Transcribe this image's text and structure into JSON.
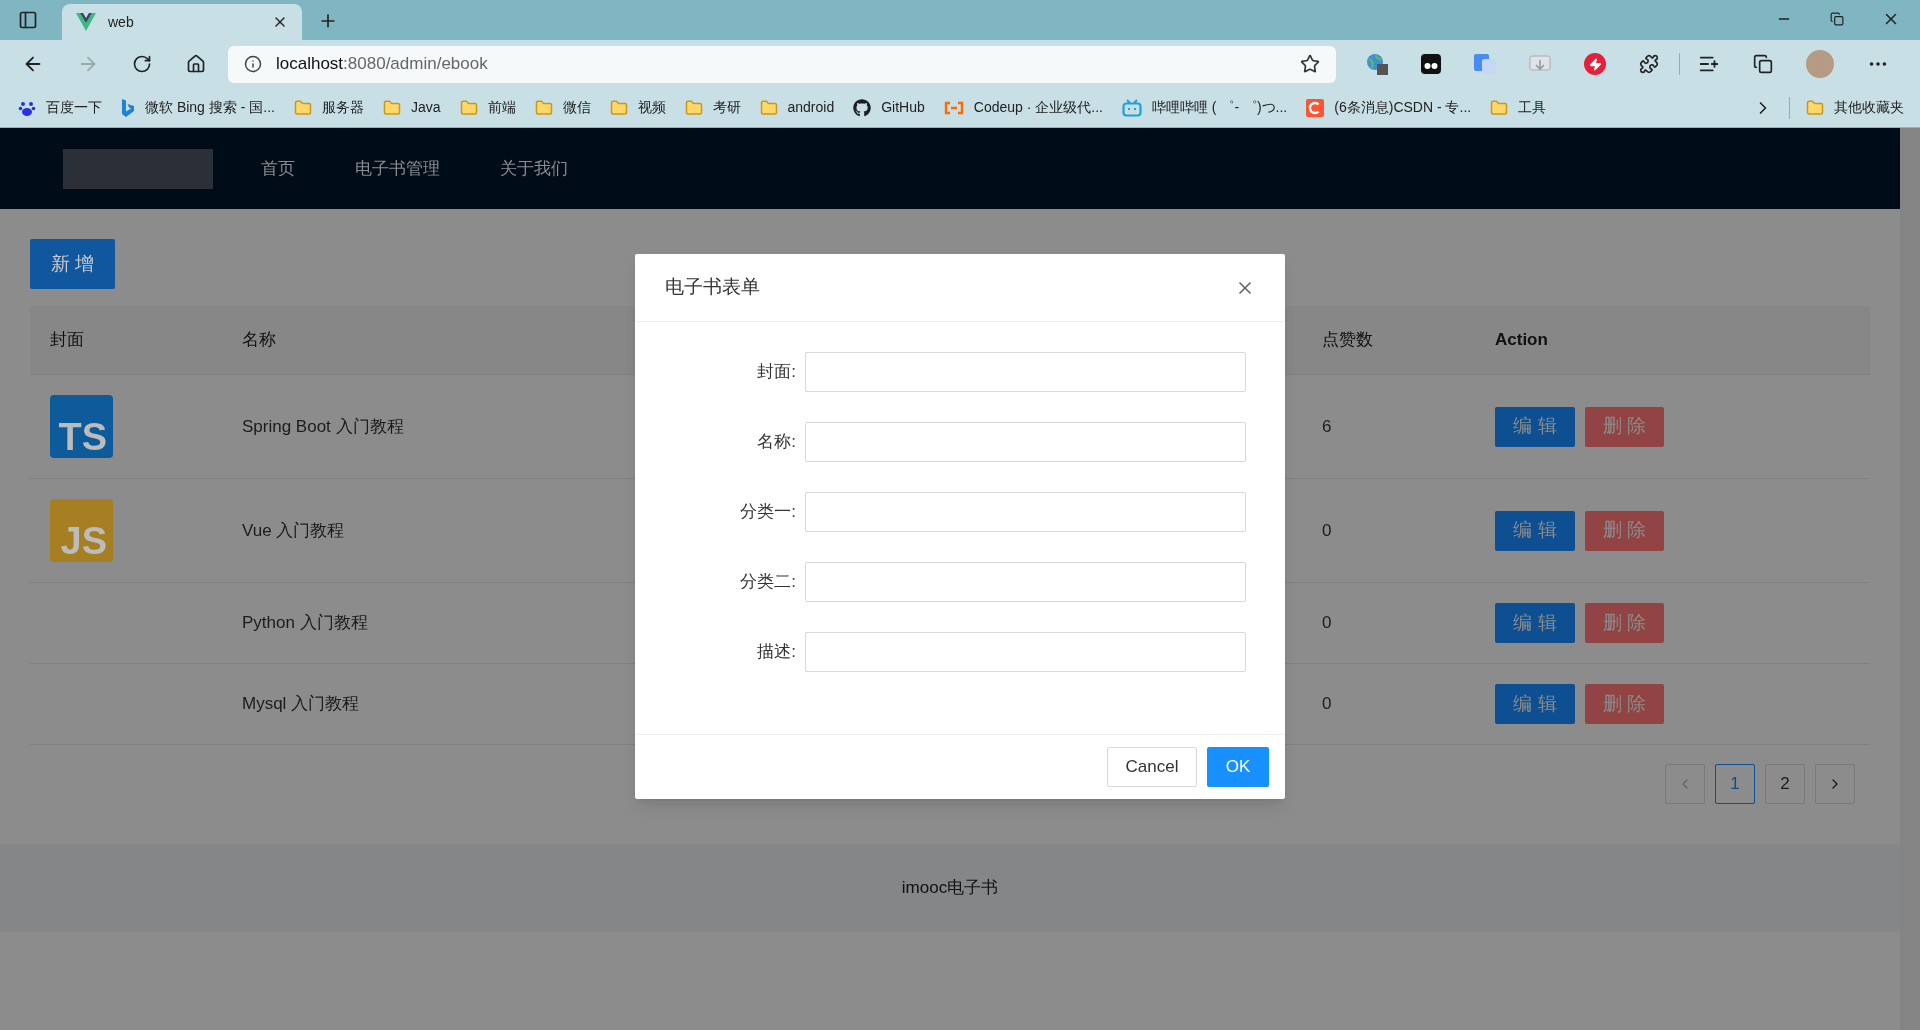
{
  "browser": {
    "tabs": [
      {
        "title": "web",
        "selected": true
      }
    ],
    "address": {
      "host": "localhost",
      "path": ":8080/admin/ebook"
    },
    "bookmarks": [
      {
        "kind": "baidu",
        "label": "百度一下"
      },
      {
        "kind": "bing",
        "label": "微软 Bing 搜索 - 国..."
      },
      {
        "kind": "folder",
        "label": "服务器"
      },
      {
        "kind": "folder",
        "label": "Java"
      },
      {
        "kind": "folder",
        "label": "前端"
      },
      {
        "kind": "folder",
        "label": "微信"
      },
      {
        "kind": "folder",
        "label": "视频"
      },
      {
        "kind": "folder",
        "label": "考研"
      },
      {
        "kind": "folder",
        "label": "android"
      },
      {
        "kind": "github",
        "label": "GitHub"
      },
      {
        "kind": "codeup",
        "label": "Codeup · 企业级代..."
      },
      {
        "kind": "bilibili",
        "label": "哔哩哔哩 ( ゜- ゜)つ..."
      },
      {
        "kind": "csdn",
        "label": "(6条消息)CSDN - 专..."
      },
      {
        "kind": "folder",
        "label": "工具"
      }
    ],
    "other_bookmarks": "其他收藏夹"
  },
  "header": {
    "nav": [
      "首页",
      "电子书管理",
      "关于我们"
    ]
  },
  "add_button": "新 增",
  "table": {
    "columns": [
      "封面",
      "名称",
      "点赞数",
      "Action"
    ],
    "rows": [
      {
        "cover": {
          "text": "TS",
          "color": "#0d5b9a"
        },
        "name": "Spring Boot 入门教程",
        "likes": "6",
        "actions": [
          "编 辑",
          "删 除"
        ]
      },
      {
        "cover": {
          "text": "JS",
          "color": "#a67f22"
        },
        "name": "Vue 入门教程",
        "likes": "0",
        "actions": [
          "编 辑",
          "删 除"
        ]
      },
      {
        "name": "Python 入门教程",
        "likes": "0",
        "actions": [
          "编 辑",
          "删 除"
        ]
      },
      {
        "name": "Mysql 入门教程",
        "likes": "0",
        "actions": [
          "编 辑",
          "删 除"
        ]
      }
    ]
  },
  "pagination": {
    "pages": [
      {
        "label": "1",
        "selected": true
      },
      {
        "label": "2",
        "selected": false
      }
    ]
  },
  "footer": "imooc电子书",
  "dialog": {
    "title": "电子书表单",
    "fields": [
      {
        "label": "封面:"
      },
      {
        "label": "名称:"
      },
      {
        "label": "分类一:"
      },
      {
        "label": "分类二:"
      },
      {
        "label": "描述:"
      }
    ],
    "cancel": "Cancel",
    "ok": "OK"
  }
}
